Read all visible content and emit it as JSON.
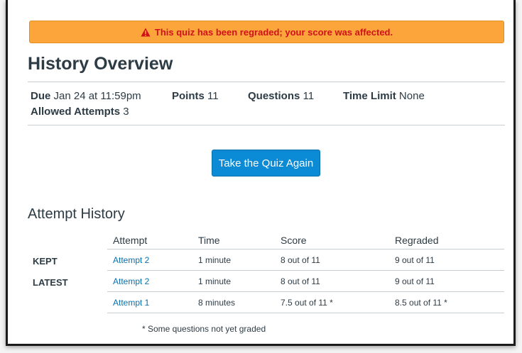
{
  "alert": {
    "text": "This quiz has been regraded; your score was affected.",
    "icon": "warning-icon",
    "color": "#d0111b",
    "background": "#fca53b"
  },
  "page_title": "History Overview",
  "details": {
    "due_label": "Due",
    "due_value": "Jan 24 at 11:59pm",
    "points_label": "Points",
    "points_value": "11",
    "questions_label": "Questions",
    "questions_value": "11",
    "time_limit_label": "Time Limit",
    "time_limit_value": "None",
    "attempts_label": "Allowed Attempts",
    "attempts_value": "3"
  },
  "take_quiz_button": "Take the Quiz Again",
  "attempt_history": {
    "heading": "Attempt History",
    "columns": [
      "Attempt",
      "Time",
      "Score",
      "Regraded"
    ],
    "rows": [
      {
        "label": "KEPT",
        "attempt": "Attempt 2",
        "time": "1 minute",
        "score": "8 out of 11",
        "regraded": "9 out of 11"
      },
      {
        "label": "LATEST",
        "attempt": "Attempt 2",
        "time": "1 minute",
        "score": "8 out of 11",
        "regraded": "9 out of 11"
      },
      {
        "label": "",
        "attempt": "Attempt 1",
        "time": "8 minutes",
        "score": "7.5 out of 11 *",
        "regraded": "8.5 out of 11 *"
      }
    ],
    "footnote": "* Some questions not yet graded"
  },
  "colors": {
    "button": "#0b8ad6",
    "link": "#0770ad",
    "text": "#2d3b45"
  }
}
